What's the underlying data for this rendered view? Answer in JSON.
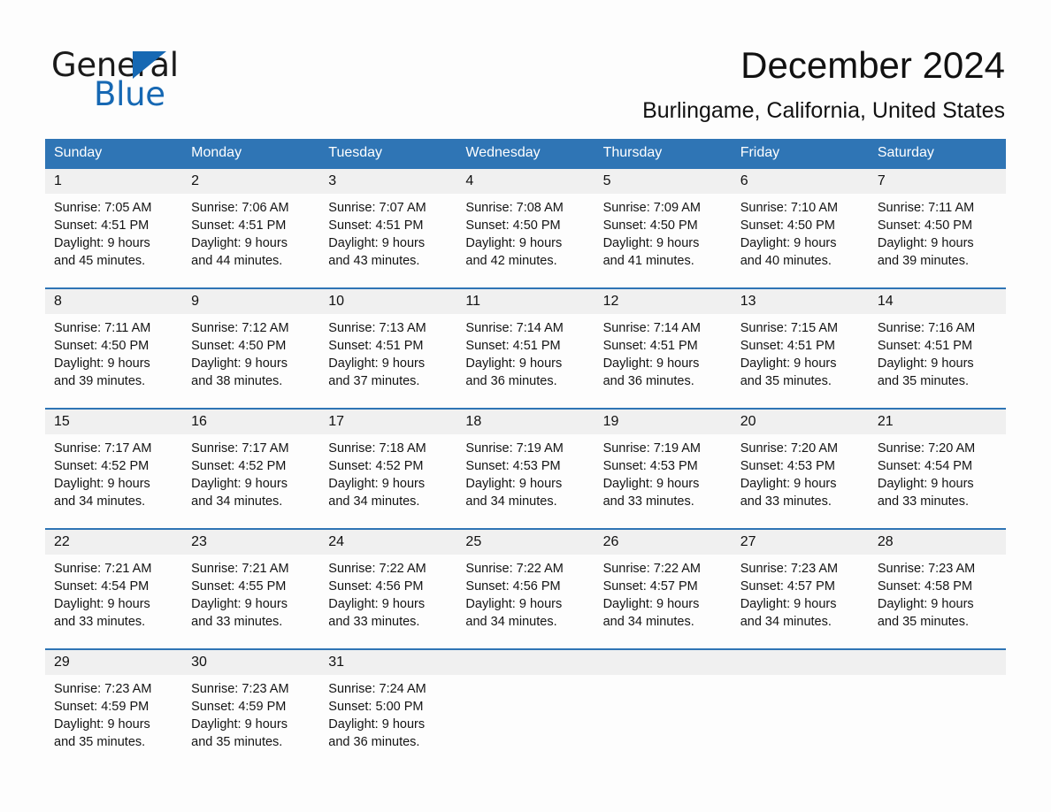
{
  "brand": {
    "name_part1": "General",
    "name_part2": "Blue",
    "accent_color": "#1668b3"
  },
  "header": {
    "month_title": "December 2024",
    "location": "Burlingame, California, United States"
  },
  "theme": {
    "header_blue": "#2f75b5",
    "daynum_bg": "#f0f0f0",
    "page_bg": "#fdfdfd"
  },
  "calendar": {
    "day_names": [
      "Sunday",
      "Monday",
      "Tuesday",
      "Wednesday",
      "Thursday",
      "Friday",
      "Saturday"
    ],
    "weeks": [
      {
        "daynums": [
          "1",
          "2",
          "3",
          "4",
          "5",
          "6",
          "7"
        ],
        "cells": [
          {
            "sunrise": "Sunrise: 7:05 AM",
            "sunset": "Sunset: 4:51 PM",
            "daylight1": "Daylight: 9 hours",
            "daylight2": "and 45 minutes."
          },
          {
            "sunrise": "Sunrise: 7:06 AM",
            "sunset": "Sunset: 4:51 PM",
            "daylight1": "Daylight: 9 hours",
            "daylight2": "and 44 minutes."
          },
          {
            "sunrise": "Sunrise: 7:07 AM",
            "sunset": "Sunset: 4:51 PM",
            "daylight1": "Daylight: 9 hours",
            "daylight2": "and 43 minutes."
          },
          {
            "sunrise": "Sunrise: 7:08 AM",
            "sunset": "Sunset: 4:50 PM",
            "daylight1": "Daylight: 9 hours",
            "daylight2": "and 42 minutes."
          },
          {
            "sunrise": "Sunrise: 7:09 AM",
            "sunset": "Sunset: 4:50 PM",
            "daylight1": "Daylight: 9 hours",
            "daylight2": "and 41 minutes."
          },
          {
            "sunrise": "Sunrise: 7:10 AM",
            "sunset": "Sunset: 4:50 PM",
            "daylight1": "Daylight: 9 hours",
            "daylight2": "and 40 minutes."
          },
          {
            "sunrise": "Sunrise: 7:11 AM",
            "sunset": "Sunset: 4:50 PM",
            "daylight1": "Daylight: 9 hours",
            "daylight2": "and 39 minutes."
          }
        ]
      },
      {
        "daynums": [
          "8",
          "9",
          "10",
          "11",
          "12",
          "13",
          "14"
        ],
        "cells": [
          {
            "sunrise": "Sunrise: 7:11 AM",
            "sunset": "Sunset: 4:50 PM",
            "daylight1": "Daylight: 9 hours",
            "daylight2": "and 39 minutes."
          },
          {
            "sunrise": "Sunrise: 7:12 AM",
            "sunset": "Sunset: 4:50 PM",
            "daylight1": "Daylight: 9 hours",
            "daylight2": "and 38 minutes."
          },
          {
            "sunrise": "Sunrise: 7:13 AM",
            "sunset": "Sunset: 4:51 PM",
            "daylight1": "Daylight: 9 hours",
            "daylight2": "and 37 minutes."
          },
          {
            "sunrise": "Sunrise: 7:14 AM",
            "sunset": "Sunset: 4:51 PM",
            "daylight1": "Daylight: 9 hours",
            "daylight2": "and 36 minutes."
          },
          {
            "sunrise": "Sunrise: 7:14 AM",
            "sunset": "Sunset: 4:51 PM",
            "daylight1": "Daylight: 9 hours",
            "daylight2": "and 36 minutes."
          },
          {
            "sunrise": "Sunrise: 7:15 AM",
            "sunset": "Sunset: 4:51 PM",
            "daylight1": "Daylight: 9 hours",
            "daylight2": "and 35 minutes."
          },
          {
            "sunrise": "Sunrise: 7:16 AM",
            "sunset": "Sunset: 4:51 PM",
            "daylight1": "Daylight: 9 hours",
            "daylight2": "and 35 minutes."
          }
        ]
      },
      {
        "daynums": [
          "15",
          "16",
          "17",
          "18",
          "19",
          "20",
          "21"
        ],
        "cells": [
          {
            "sunrise": "Sunrise: 7:17 AM",
            "sunset": "Sunset: 4:52 PM",
            "daylight1": "Daylight: 9 hours",
            "daylight2": "and 34 minutes."
          },
          {
            "sunrise": "Sunrise: 7:17 AM",
            "sunset": "Sunset: 4:52 PM",
            "daylight1": "Daylight: 9 hours",
            "daylight2": "and 34 minutes."
          },
          {
            "sunrise": "Sunrise: 7:18 AM",
            "sunset": "Sunset: 4:52 PM",
            "daylight1": "Daylight: 9 hours",
            "daylight2": "and 34 minutes."
          },
          {
            "sunrise": "Sunrise: 7:19 AM",
            "sunset": "Sunset: 4:53 PM",
            "daylight1": "Daylight: 9 hours",
            "daylight2": "and 34 minutes."
          },
          {
            "sunrise": "Sunrise: 7:19 AM",
            "sunset": "Sunset: 4:53 PM",
            "daylight1": "Daylight: 9 hours",
            "daylight2": "and 33 minutes."
          },
          {
            "sunrise": "Sunrise: 7:20 AM",
            "sunset": "Sunset: 4:53 PM",
            "daylight1": "Daylight: 9 hours",
            "daylight2": "and 33 minutes."
          },
          {
            "sunrise": "Sunrise: 7:20 AM",
            "sunset": "Sunset: 4:54 PM",
            "daylight1": "Daylight: 9 hours",
            "daylight2": "and 33 minutes."
          }
        ]
      },
      {
        "daynums": [
          "22",
          "23",
          "24",
          "25",
          "26",
          "27",
          "28"
        ],
        "cells": [
          {
            "sunrise": "Sunrise: 7:21 AM",
            "sunset": "Sunset: 4:54 PM",
            "daylight1": "Daylight: 9 hours",
            "daylight2": "and 33 minutes."
          },
          {
            "sunrise": "Sunrise: 7:21 AM",
            "sunset": "Sunset: 4:55 PM",
            "daylight1": "Daylight: 9 hours",
            "daylight2": "and 33 minutes."
          },
          {
            "sunrise": "Sunrise: 7:22 AM",
            "sunset": "Sunset: 4:56 PM",
            "daylight1": "Daylight: 9 hours",
            "daylight2": "and 33 minutes."
          },
          {
            "sunrise": "Sunrise: 7:22 AM",
            "sunset": "Sunset: 4:56 PM",
            "daylight1": "Daylight: 9 hours",
            "daylight2": "and 34 minutes."
          },
          {
            "sunrise": "Sunrise: 7:22 AM",
            "sunset": "Sunset: 4:57 PM",
            "daylight1": "Daylight: 9 hours",
            "daylight2": "and 34 minutes."
          },
          {
            "sunrise": "Sunrise: 7:23 AM",
            "sunset": "Sunset: 4:57 PM",
            "daylight1": "Daylight: 9 hours",
            "daylight2": "and 34 minutes."
          },
          {
            "sunrise": "Sunrise: 7:23 AM",
            "sunset": "Sunset: 4:58 PM",
            "daylight1": "Daylight: 9 hours",
            "daylight2": "and 35 minutes."
          }
        ]
      },
      {
        "daynums": [
          "29",
          "30",
          "31",
          "",
          "",
          "",
          ""
        ],
        "cells": [
          {
            "sunrise": "Sunrise: 7:23 AM",
            "sunset": "Sunset: 4:59 PM",
            "daylight1": "Daylight: 9 hours",
            "daylight2": "and 35 minutes."
          },
          {
            "sunrise": "Sunrise: 7:23 AM",
            "sunset": "Sunset: 4:59 PM",
            "daylight1": "Daylight: 9 hours",
            "daylight2": "and 35 minutes."
          },
          {
            "sunrise": "Sunrise: 7:24 AM",
            "sunset": "Sunset: 5:00 PM",
            "daylight1": "Daylight: 9 hours",
            "daylight2": "and 36 minutes."
          },
          {
            "sunrise": "",
            "sunset": "",
            "daylight1": "",
            "daylight2": ""
          },
          {
            "sunrise": "",
            "sunset": "",
            "daylight1": "",
            "daylight2": ""
          },
          {
            "sunrise": "",
            "sunset": "",
            "daylight1": "",
            "daylight2": ""
          },
          {
            "sunrise": "",
            "sunset": "",
            "daylight1": "",
            "daylight2": ""
          }
        ]
      }
    ]
  }
}
